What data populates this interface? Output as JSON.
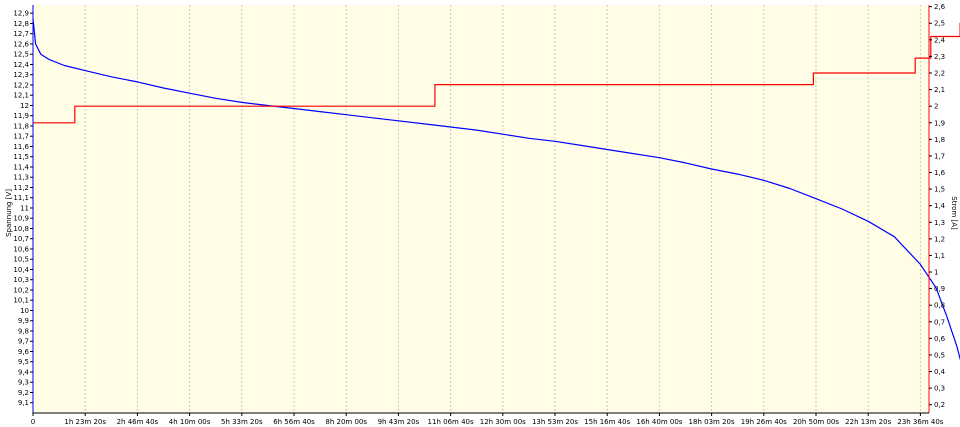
{
  "chart_data": {
    "type": "line",
    "background": "#fffde6",
    "grid": true,
    "colors": {
      "voltage": "#0000ff",
      "current": "#ff0000",
      "grid": "#c8c8c8"
    },
    "y_left": {
      "label": "Spannung [V]",
      "ticks": [
        "9,1",
        "9,2",
        "9,3",
        "9,4",
        "9,5",
        "9,6",
        "9,7",
        "9,8",
        "9,9",
        "10",
        "10,1",
        "10,2",
        "10,3",
        "10,4",
        "10,5",
        "10,6",
        "10,7",
        "10,8",
        "10,9",
        "11",
        "11,1",
        "11,2",
        "11,3",
        "11,4",
        "11,5",
        "11,6",
        "11,7",
        "11,8",
        "11,9",
        "12",
        "12,1",
        "12,2",
        "12,3",
        "12,4",
        "12,5",
        "12,6",
        "12,7",
        "12,8",
        "12,9"
      ],
      "range": [
        9.0,
        12.98
      ]
    },
    "y_right": {
      "label": "Strom [A]",
      "ticks": [
        "0,2",
        "0,3",
        "0,4",
        "0,5",
        "0,6",
        "0,7",
        "0,8",
        "0,9",
        "1",
        "1,1",
        "1,2",
        "1,3",
        "1,4",
        "1,5",
        "1,6",
        "1,7",
        "1,8",
        "1,9",
        "2",
        "2,1",
        "2,2",
        "2,3",
        "2,4",
        "2,5",
        "2,6"
      ],
      "range": [
        0.15,
        2.61
      ]
    },
    "x_axis": {
      "ticks": [
        "0",
        "1h 23m 20s",
        "2h 46m 40s",
        "4h 10m 00s",
        "5h 33m 20s",
        "6h 56m 40s",
        "8h 20m 00s",
        "9h 43m 20s",
        "11h 06m 40s",
        "12h 30m 00s",
        "13h 53m 20s",
        "15h 16m 40s",
        "16h 40m 00s",
        "18h 03m 20s",
        "19h 26m 40s",
        "20h 50m 00s",
        "22h 13m 20s",
        "23h 36m 40s"
      ]
    },
    "series": [
      {
        "axis": "left",
        "color": "#0000ff",
        "x_index": [
          0,
          0.05,
          0.15,
          0.3,
          0.6,
          1.0,
          1.5,
          2.0,
          2.5,
          3.0,
          3.5,
          4.0,
          4.5,
          5.0,
          5.5,
          6.0,
          6.5,
          7.0,
          7.5,
          8.0,
          8.5,
          9.0,
          9.5,
          10.0,
          10.5,
          11.0,
          11.5,
          12.0,
          12.5,
          13.0,
          13.5,
          14.0,
          14.5,
          15.0,
          15.5,
          16.0,
          16.5,
          17.0,
          17.3,
          17.5,
          17.7,
          17.8,
          17.9,
          17.95,
          18.0
        ],
        "values": [
          12.85,
          12.6,
          12.5,
          12.45,
          12.39,
          12.34,
          12.28,
          12.23,
          12.17,
          12.12,
          12.07,
          12.03,
          12.0,
          11.97,
          11.94,
          11.91,
          11.88,
          11.85,
          11.82,
          11.79,
          11.76,
          11.72,
          11.68,
          11.65,
          11.61,
          11.57,
          11.53,
          11.49,
          11.44,
          11.38,
          11.33,
          11.27,
          11.19,
          11.09,
          10.99,
          10.87,
          10.72,
          10.45,
          10.22,
          9.95,
          9.65,
          9.45,
          9.25,
          9.15,
          9.1
        ]
      },
      {
        "axis": "right",
        "color": "#ff0000",
        "x_index": [
          0,
          0.8,
          0.8,
          7.7,
          7.7,
          14.95,
          14.95,
          16.9,
          16.9,
          17.2,
          17.2,
          17.76,
          17.76,
          17.92,
          17.92
        ],
        "values": [
          1.9,
          1.9,
          2.0,
          2.0,
          2.13,
          2.13,
          2.2,
          2.2,
          2.29,
          2.29,
          2.42,
          2.42,
          2.5,
          2.5,
          2.61
        ]
      }
    ]
  }
}
